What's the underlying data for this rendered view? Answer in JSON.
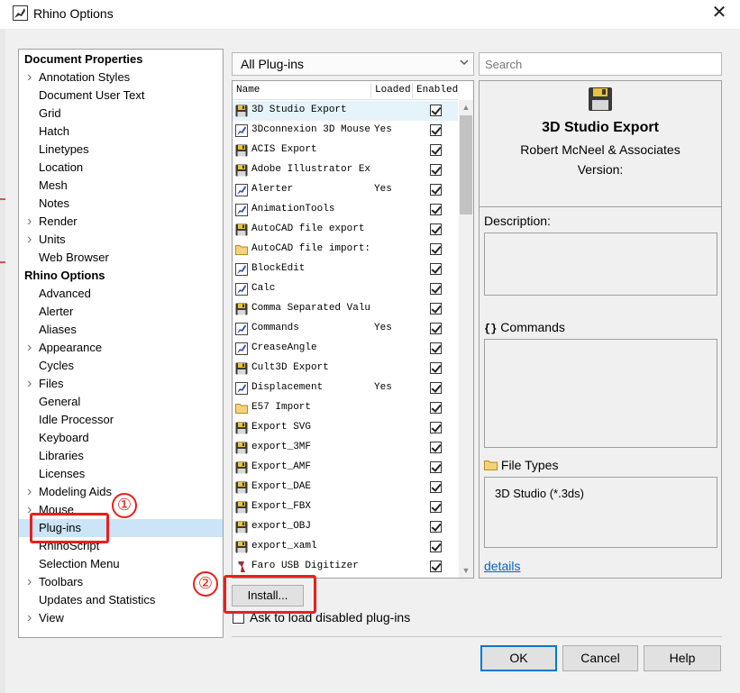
{
  "window": {
    "title": "Rhino Options",
    "close_glyph": "✕"
  },
  "tree": {
    "items": [
      {
        "label": "Document Properties",
        "header": true
      },
      {
        "label": "Annotation Styles",
        "arrow": true
      },
      {
        "label": "Document User Text"
      },
      {
        "label": "Grid"
      },
      {
        "label": "Hatch"
      },
      {
        "label": "Linetypes"
      },
      {
        "label": "Location"
      },
      {
        "label": "Mesh"
      },
      {
        "label": "Notes"
      },
      {
        "label": "Render",
        "arrow": true
      },
      {
        "label": "Units",
        "arrow": true
      },
      {
        "label": "Web Browser"
      },
      {
        "label": "Rhino Options",
        "header": true
      },
      {
        "label": "Advanced"
      },
      {
        "label": "Alerter"
      },
      {
        "label": "Aliases"
      },
      {
        "label": "Appearance",
        "arrow": true
      },
      {
        "label": "Cycles"
      },
      {
        "label": "Files",
        "arrow": true
      },
      {
        "label": "General"
      },
      {
        "label": "Idle Processor"
      },
      {
        "label": "Keyboard"
      },
      {
        "label": "Libraries"
      },
      {
        "label": "Licenses"
      },
      {
        "label": "Modeling Aids",
        "arrow": true
      },
      {
        "label": "Mouse",
        "arrow": true
      },
      {
        "label": "Plug-ins",
        "selected": true
      },
      {
        "label": "RhinoScript"
      },
      {
        "label": "Selection Menu"
      },
      {
        "label": "Toolbars",
        "arrow": true
      },
      {
        "label": "Updates and Statistics"
      },
      {
        "label": "View",
        "arrow": true
      }
    ]
  },
  "filter": {
    "value": "All Plug-ins",
    "chevron": "⌄"
  },
  "search": {
    "placeholder": "Search"
  },
  "plugin_list": {
    "columns": {
      "name": "Name",
      "loaded": "Loaded",
      "enabled": "Enabled"
    },
    "rows": [
      {
        "icon": "floppy-disk-icon",
        "name": "3D Studio Export",
        "loaded": "",
        "enabled": true,
        "selected": true
      },
      {
        "icon": "plugin-icon",
        "name": "3Dconnexion 3D Mouse",
        "loaded": "Yes",
        "enabled": true
      },
      {
        "icon": "floppy-disk-icon",
        "name": "ACIS Export",
        "loaded": "",
        "enabled": true
      },
      {
        "icon": "floppy-disk-icon",
        "name": "Adobe Illustrator Expo",
        "loaded": "",
        "enabled": true
      },
      {
        "icon": "plugin-icon",
        "name": "Alerter",
        "loaded": "Yes",
        "enabled": true
      },
      {
        "icon": "plugin-icon",
        "name": "AnimationTools",
        "loaded": "",
        "enabled": true
      },
      {
        "icon": "floppy-disk-icon",
        "name": "AutoCAD file export :",
        "loaded": "",
        "enabled": true
      },
      {
        "icon": "folder-icon",
        "name": "AutoCAD file import: i",
        "loaded": "",
        "enabled": true
      },
      {
        "icon": "plugin-icon",
        "name": "BlockEdit",
        "loaded": "",
        "enabled": true
      },
      {
        "icon": "plugin-icon",
        "name": "Calc",
        "loaded": "",
        "enabled": true
      },
      {
        "icon": "floppy-disk-icon",
        "name": "Comma Separated Value",
        "loaded": "",
        "enabled": true
      },
      {
        "icon": "plugin-icon",
        "name": "Commands",
        "loaded": "Yes",
        "enabled": true
      },
      {
        "icon": "plugin-icon",
        "name": "CreaseAngle",
        "loaded": "",
        "enabled": true
      },
      {
        "icon": "floppy-disk-icon",
        "name": "Cult3D Export",
        "loaded": "",
        "enabled": true
      },
      {
        "icon": "plugin-icon",
        "name": "Displacement",
        "loaded": "Yes",
        "enabled": true
      },
      {
        "icon": "folder-icon",
        "name": "E57 Import",
        "loaded": "",
        "enabled": true
      },
      {
        "icon": "floppy-disk-icon",
        "name": "Export SVG",
        "loaded": "",
        "enabled": true
      },
      {
        "icon": "floppy-disk-icon",
        "name": "export_3MF",
        "loaded": "",
        "enabled": true
      },
      {
        "icon": "floppy-disk-icon",
        "name": "Export_AMF",
        "loaded": "",
        "enabled": true
      },
      {
        "icon": "floppy-disk-icon",
        "name": "Export_DAE",
        "loaded": "",
        "enabled": true
      },
      {
        "icon": "floppy-disk-icon",
        "name": "Export_FBX",
        "loaded": "",
        "enabled": true
      },
      {
        "icon": "floppy-disk-icon",
        "name": "export_OBJ",
        "loaded": "",
        "enabled": true
      },
      {
        "icon": "floppy-disk-icon",
        "name": "export_xaml",
        "loaded": "",
        "enabled": true
      },
      {
        "icon": "digitizer-icon",
        "name": "Faro USB Digitizer",
        "loaded": "",
        "enabled": true
      }
    ]
  },
  "detail": {
    "name": "3D Studio Export",
    "author": "Robert McNeel & Associates",
    "version_label": "Version:",
    "description_label": "Description:",
    "commands_label": "Commands",
    "commands_glyph": "{}",
    "file_types_label": "File Types",
    "file_types_value": "3D Studio (*.3ds)",
    "details_link": "details"
  },
  "install_button": "Install...",
  "ask_checkbox": {
    "label": "Ask to load disabled plug-ins",
    "checked": false
  },
  "buttons": {
    "ok": "OK",
    "cancel": "Cancel",
    "help": "Help"
  },
  "annotations": {
    "step1": "①",
    "step2": "②",
    "color": "#e8201c"
  }
}
